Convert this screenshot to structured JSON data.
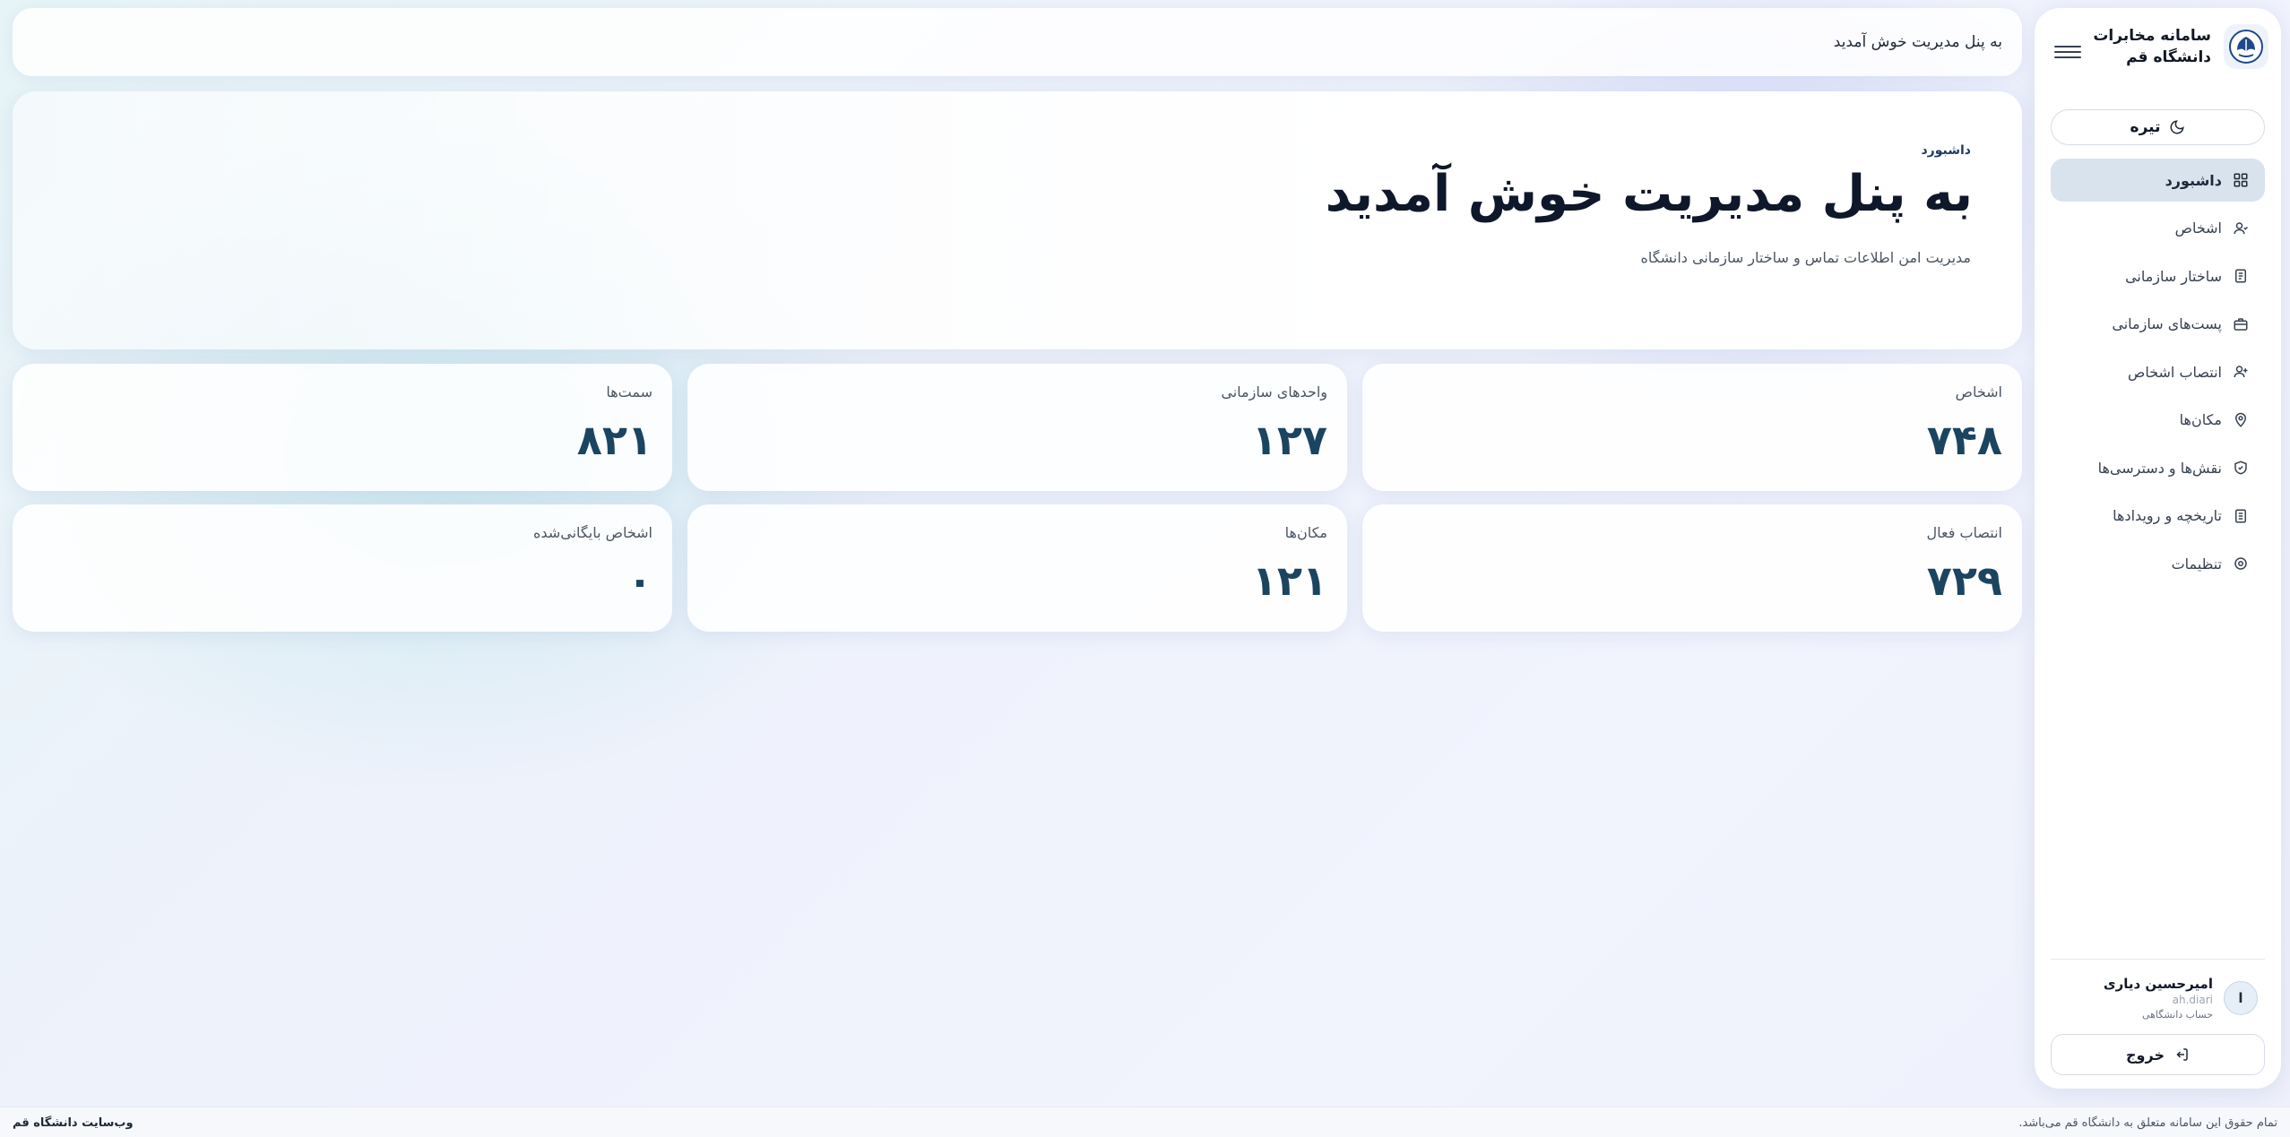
{
  "brand": {
    "title_line1": "سامانه مخابرات",
    "title_line2": "دانشگاه قم",
    "logo_icon": "university-logo-icon"
  },
  "theme_toggle": {
    "label": "تیره",
    "icon": "moon-icon"
  },
  "nav": {
    "items": [
      {
        "label": "داشبورد",
        "icon": "grid-icon",
        "active": true
      },
      {
        "label": "اشخاص",
        "icon": "user-icon",
        "active": false
      },
      {
        "label": "ساختار سازمانی",
        "icon": "document-icon",
        "active": false
      },
      {
        "label": "پست‌های سازمانی",
        "icon": "briefcase-icon",
        "active": false
      },
      {
        "label": "انتصاب اشخاص",
        "icon": "user-plus-icon",
        "active": false
      },
      {
        "label": "مکان‌ها",
        "icon": "map-pin-icon",
        "active": false
      },
      {
        "label": "نقش‌ها و دسترسی‌ها",
        "icon": "shield-icon",
        "active": false
      },
      {
        "label": "تاریخچه و رویدادها",
        "icon": "history-icon",
        "active": false
      },
      {
        "label": "تنظیمات",
        "icon": "settings-icon",
        "active": false
      }
    ]
  },
  "user": {
    "initial": "ا",
    "name": "امیرحسین دیاری",
    "handle": "ah.diari",
    "role": "حساب دانشگاهی"
  },
  "logout": {
    "label": "خروج",
    "icon": "logout-icon"
  },
  "topbar": {
    "title": "به پنل مدیریت خوش آمدید"
  },
  "hero": {
    "breadcrumb": "داشبورد",
    "title": "به پنل مدیریت خوش آمدید",
    "subtitle": "مدیریت امن اطلاعات تماس و ساختار سازمانی دانشگاه"
  },
  "stats": [
    {
      "label": "اشخاص",
      "value": "۷۴۸"
    },
    {
      "label": "واحدهای سازمانی",
      "value": "۱۲۷"
    },
    {
      "label": "سمت‌ها",
      "value": "۸۲۱"
    },
    {
      "label": "انتصاب فعال",
      "value": "۷۲۹"
    },
    {
      "label": "مکان‌ها",
      "value": "۱۲۱"
    },
    {
      "label": "اشخاص بایگانی‌شده",
      "value": "۰"
    }
  ],
  "footer": {
    "copyright": "تمام حقوق این سامانه متعلق به دانشگاه قم می‌باشد.",
    "website_link": "وب‌سایت دانشگاه قم"
  },
  "colors": {
    "accent": "#1b4461",
    "active_nav_bg": "#d8e3ee",
    "title": "#0f172a"
  }
}
